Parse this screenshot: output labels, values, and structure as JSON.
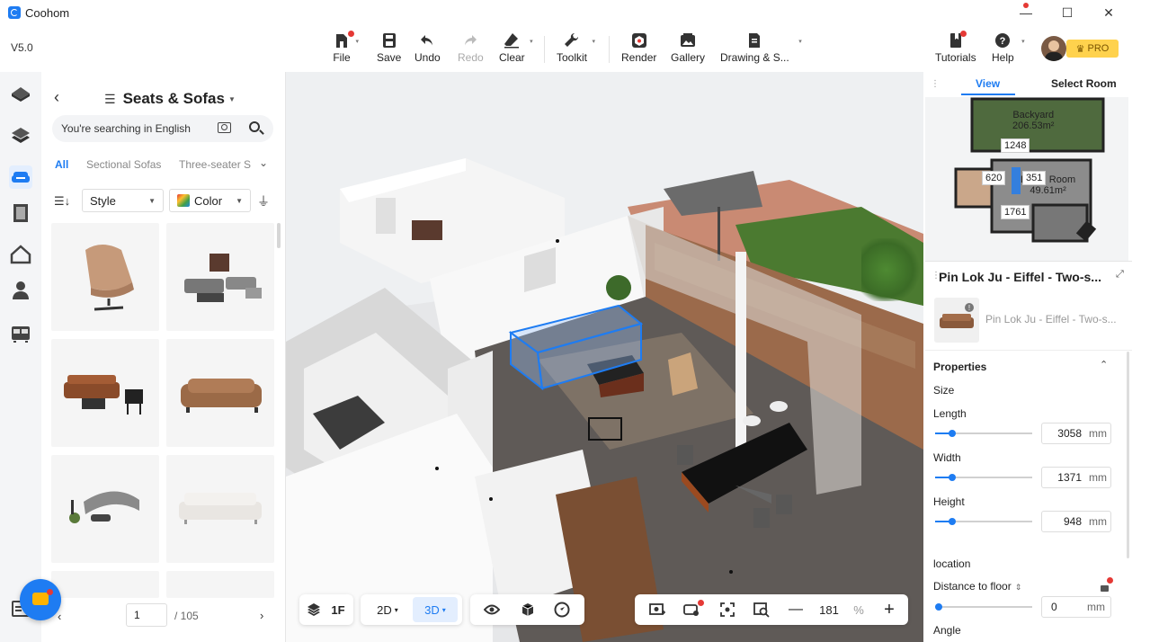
{
  "window": {
    "title": "Coohom",
    "minimize": "—",
    "maximize": "☐",
    "close": "✕"
  },
  "version": "V5.0",
  "toolbar": {
    "file": "File",
    "save": "Save",
    "undo": "Undo",
    "redo": "Redo",
    "clear": "Clear",
    "toolkit": "Toolkit",
    "render": "Render",
    "gallery": "Gallery",
    "drawing": "Drawing & S...",
    "tutorials": "Tutorials",
    "help": "Help",
    "pro_badge": "PRO"
  },
  "catalog": {
    "back_icon": "‹",
    "title": "Seats & Sofas",
    "search_placeholder": "You're searching in English",
    "tabs": [
      "All",
      "Sectional Sofas",
      "Three-seater S"
    ],
    "tabs_more": "⌄",
    "filters": {
      "style": "Style",
      "color": "Color"
    },
    "pager": {
      "page": "1",
      "total": "/ 105",
      "prev": "‹",
      "next": "›"
    }
  },
  "bottom_bar": {
    "floor": "1F",
    "mode_2d": "2D",
    "mode_3d": "3D",
    "zoom_value": "181",
    "zoom_unit": "%",
    "zoom_out": "—",
    "zoom_in": "+"
  },
  "right_panel": {
    "tabs": {
      "view": "View",
      "select_room": "Select Room"
    },
    "minimap": {
      "room1_name": "Backyard",
      "room1_area": "206.53m²",
      "room2_name": "Living Room",
      "room2_area": "49.61m²",
      "dims": [
        "1248",
        "620",
        "351",
        "1761"
      ]
    },
    "selected_title": "Pin Lok Ju - Eiffel - Two-s...",
    "product_name": "Pin Lok Ju - Eiffel - Two-s...",
    "sections": {
      "properties": "Properties",
      "size": "Size",
      "location": "location",
      "angle": "Angle"
    },
    "fields": {
      "length": {
        "label": "Length",
        "value": "3058",
        "unit": "mm",
        "fraction": 0.18
      },
      "width": {
        "label": "Width",
        "value": "1371",
        "unit": "mm",
        "fraction": 0.18
      },
      "height": {
        "label": "Height",
        "value": "948",
        "unit": "mm",
        "fraction": 0.18
      },
      "distance": {
        "label": "Distance to floor",
        "value": "0",
        "unit": "mm",
        "fraction": 0.0
      }
    }
  },
  "colors": {
    "accent": "#1e7cf2",
    "badge": "#e53935",
    "pro": "#ffd24d"
  }
}
